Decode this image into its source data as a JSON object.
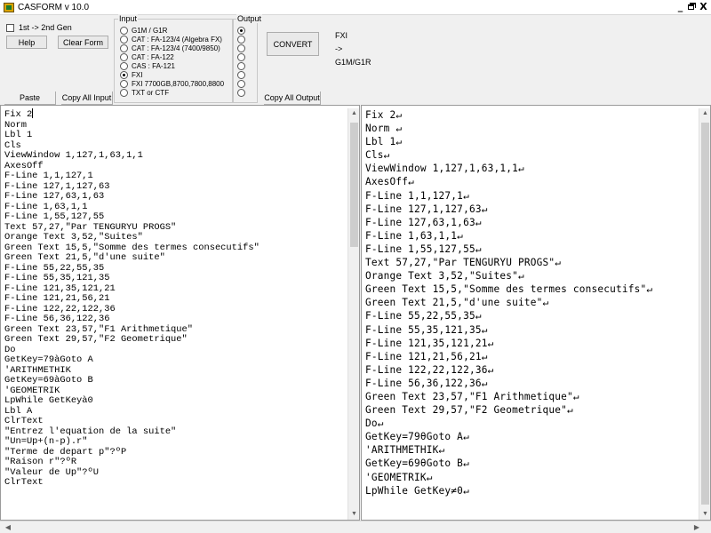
{
  "window": {
    "title": "CASFORM v 10.0",
    "controls": [
      "_",
      "г",
      "X"
    ]
  },
  "toolbar": {
    "gen_label": "1st -> 2nd Gen",
    "help": "Help",
    "clear_form": "Clear Form",
    "paste": "Paste",
    "copy_all_input": "Copy All Input",
    "convert": "CONVERT",
    "copy_all_output": "Copy All Output",
    "input_legend": "Input",
    "output_legend": "Output",
    "input_options": [
      "G1M / G1R",
      "CAT : FA-123/4  (Algebra FX)",
      "CAT : FA-123/4 (7400/9850)",
      "CAT : FA-122",
      "CAS : FA-121",
      "FXI",
      "FXI 7700GB,8700,7800,8800",
      "TXT or CTF"
    ],
    "input_selected": 5,
    "output_selected": 0,
    "status_from": "FXI",
    "status_arrow": "->",
    "status_to": "G1M/G1R"
  },
  "input_code": [
    "Fix 2",
    "Norm",
    "Lbl 1",
    "Cls",
    "ViewWindow 1,127,1,63,1,1",
    "AxesOff",
    "F-Line 1,1,127,1",
    "F-Line 127,1,127,63",
    "F-Line 127,63,1,63",
    "F-Line 1,63,1,1",
    "F-Line 1,55,127,55",
    "Text 57,27,\"Par TENGURYU PROGS\"",
    "Orange Text 3,52,\"Suites\"",
    "Green Text 15,5,\"Somme des termes consecutifs\"",
    "Green Text 21,5,\"d'une suite\"",
    "F-Line 55,22,55,35",
    "F-Line 55,35,121,35",
    "F-Line 121,35,121,21",
    "F-Line 121,21,56,21",
    "F-Line 122,22,122,36",
    "F-Line 56,36,122,36",
    "Green Text 23,57,\"F1 Arithmetique\"",
    "Green Text 29,57,\"F2 Geometrique\"",
    "Do",
    "GetKey=79àGoto A",
    "'ARITHMETHIK",
    "GetKey=69àGoto B",
    "'GEOMETRIK",
    "LpWhile GetKeyà0",
    "Lbl A",
    "ClrText",
    "\"Entrez l'equation de la suite\"",
    "\"Un=Up+(n-p).r\"",
    "\"Terme de depart p\"?ºP",
    "\"Raison r\"?ºR",
    "\"Valeur de Up\"?ºU",
    "ClrText"
  ],
  "output_code": [
    "Fix 2↵",
    "Norm ↵",
    "Lbl 1↵",
    "Cls↵",
    "ViewWindow 1,127,1,63,1,1↵",
    "AxesOff↵",
    "F-Line 1,1,127,1↵",
    "F-Line 127,1,127,63↵",
    "F-Line 127,63,1,63↵",
    "F-Line 1,63,1,1↵",
    "F-Line 1,55,127,55↵",
    "Text 57,27,\"Par TENGURYU PROGS\"↵",
    "Orange Text 3,52,\"Suites\"↵",
    "Green Text 15,5,\"Somme des termes consecutifs\"↵",
    "Green Text 21,5,\"d'une suite\"↵",
    "F-Line 55,22,55,35↵",
    "F-Line 55,35,121,35↵",
    "F-Line 121,35,121,21↵",
    "F-Line 121,21,56,21↵",
    "F-Line 122,22,122,36↵",
    "F-Line 56,36,122,36↵",
    "Green Text 23,57,\"F1 Arithmetique\"↵",
    "Green Text 29,57,\"F2 Geometrique\"↵",
    "Do↵",
    "GetKey=79θGoto A↵",
    "'ARITHMETHIK↵",
    "GetKey=69θGoto B↵",
    "'GEOMETRIK↵",
    "LpWhile GetKey≠0↵"
  ]
}
